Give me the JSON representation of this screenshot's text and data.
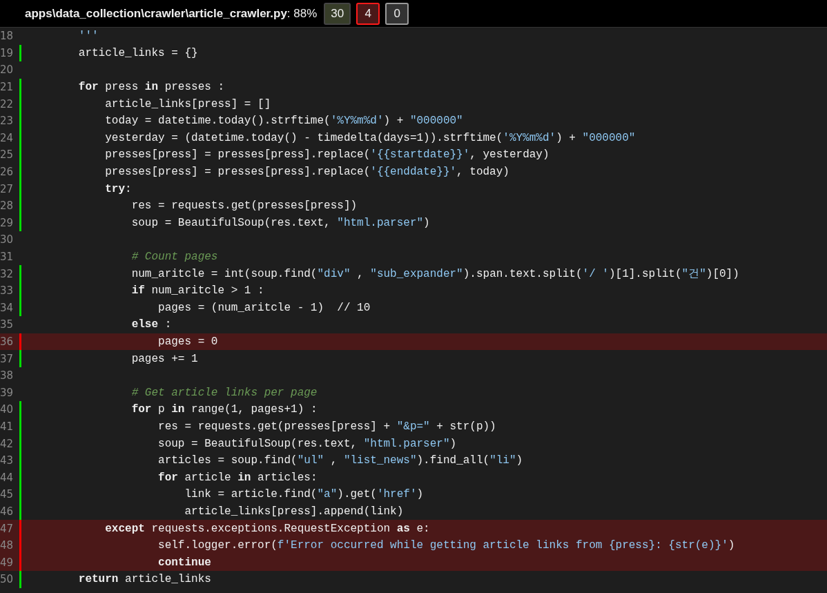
{
  "header": {
    "file": "apps\\data_collection\\crawler\\article_crawler.py",
    "coverage": ": 88%",
    "buttons": [
      {
        "kind": "run",
        "label": "30",
        "selected": false
      },
      {
        "kind": "mis",
        "label": "4",
        "selected": true
      },
      {
        "kind": "exc",
        "label": "0",
        "selected": true
      }
    ]
  },
  "lines": [
    {
      "n": "18",
      "kind": "none",
      "tokens": [
        {
          "kind": "str",
          "text": "        '''"
        }
      ]
    },
    {
      "n": "19",
      "kind": "run",
      "tokens": [
        {
          "kind": "txt",
          "text": "        article_links = {}"
        }
      ]
    },
    {
      "n": "20",
      "kind": "none"
    },
    {
      "n": "21",
      "kind": "run",
      "tokens": [
        {
          "kind": "kw",
          "text": "        for"
        },
        {
          "kind": "txt",
          "text": " press "
        },
        {
          "kind": "kw",
          "text": "in"
        },
        {
          "kind": "txt",
          "text": " presses :"
        }
      ]
    },
    {
      "n": "22",
      "kind": "run",
      "tokens": [
        {
          "kind": "txt",
          "text": "            article_links[press] = []"
        }
      ]
    },
    {
      "n": "23",
      "kind": "run",
      "tokens": [
        {
          "kind": "txt",
          "text": "            today = datetime.today().strftime("
        },
        {
          "kind": "str",
          "text": "'%Y%m%d'"
        },
        {
          "kind": "txt",
          "text": ") + "
        },
        {
          "kind": "str",
          "text": "\"000000\""
        }
      ]
    },
    {
      "n": "24",
      "kind": "run",
      "tokens": [
        {
          "kind": "txt",
          "text": "            yesterday = (datetime.today() - timedelta(days=1)).strftime("
        },
        {
          "kind": "str",
          "text": "'%Y%m%d'"
        },
        {
          "kind": "txt",
          "text": ") + "
        },
        {
          "kind": "str",
          "text": "\"000000\""
        }
      ]
    },
    {
      "n": "25",
      "kind": "run",
      "tokens": [
        {
          "kind": "txt",
          "text": "            presses[press] = presses[press].replace("
        },
        {
          "kind": "str",
          "text": "'{{startdate}}'"
        },
        {
          "kind": "txt",
          "text": ", yesterday)"
        }
      ]
    },
    {
      "n": "26",
      "kind": "run",
      "tokens": [
        {
          "kind": "txt",
          "text": "            presses[press] = presses[press].replace("
        },
        {
          "kind": "str",
          "text": "'{{enddate}}'"
        },
        {
          "kind": "txt",
          "text": ", today)"
        }
      ]
    },
    {
      "n": "27",
      "kind": "run",
      "tokens": [
        {
          "kind": "kw",
          "text": "            try"
        },
        {
          "kind": "txt",
          "text": ":"
        }
      ]
    },
    {
      "n": "28",
      "kind": "run",
      "tokens": [
        {
          "kind": "txt",
          "text": "                res = requests.get(presses[press])"
        }
      ]
    },
    {
      "n": "29",
      "kind": "run",
      "tokens": [
        {
          "kind": "txt",
          "text": "                soup = BeautifulSoup(res.text, "
        },
        {
          "kind": "str",
          "text": "\"html.parser\""
        },
        {
          "kind": "txt",
          "text": ")"
        }
      ]
    },
    {
      "n": "30",
      "kind": "none"
    },
    {
      "n": "31",
      "kind": "none",
      "tokens": [
        {
          "kind": "com",
          "text": "                # Count pages"
        }
      ]
    },
    {
      "n": "32",
      "kind": "run",
      "tokens": [
        {
          "kind": "txt",
          "text": "                num_aritcle = int(soup.find("
        },
        {
          "kind": "str",
          "text": "\"div\""
        },
        {
          "kind": "txt",
          "text": " , "
        },
        {
          "kind": "str",
          "text": "\"sub_expander\""
        },
        {
          "kind": "txt",
          "text": ").span.text.split("
        },
        {
          "kind": "str",
          "text": "'/ '"
        },
        {
          "kind": "txt",
          "text": ")[1].split("
        },
        {
          "kind": "str",
          "text": "\"건\""
        },
        {
          "kind": "txt",
          "text": ")[0])"
        }
      ]
    },
    {
      "n": "33",
      "kind": "run",
      "tokens": [
        {
          "kind": "kw",
          "text": "                if"
        },
        {
          "kind": "txt",
          "text": " num_aritcle > 1 :"
        }
      ]
    },
    {
      "n": "34",
      "kind": "run",
      "tokens": [
        {
          "kind": "txt",
          "text": "                    pages = (num_aritcle - 1)  // 10"
        }
      ]
    },
    {
      "n": "35",
      "kind": "none",
      "tokens": [
        {
          "kind": "kw",
          "text": "                else"
        },
        {
          "kind": "txt",
          "text": " :"
        }
      ]
    },
    {
      "n": "36",
      "kind": "mis",
      "tokens": [
        {
          "kind": "txt",
          "text": "                    pages = 0"
        }
      ]
    },
    {
      "n": "37",
      "kind": "run",
      "tokens": [
        {
          "kind": "txt",
          "text": "                pages += 1"
        }
      ]
    },
    {
      "n": "38",
      "kind": "none"
    },
    {
      "n": "39",
      "kind": "none",
      "tokens": [
        {
          "kind": "com",
          "text": "                # Get article links per page"
        }
      ]
    },
    {
      "n": "40",
      "kind": "run",
      "tokens": [
        {
          "kind": "kw",
          "text": "                for"
        },
        {
          "kind": "txt",
          "text": " p "
        },
        {
          "kind": "kw",
          "text": "in"
        },
        {
          "kind": "txt",
          "text": " range(1, pages+1) :"
        }
      ]
    },
    {
      "n": "41",
      "kind": "run",
      "tokens": [
        {
          "kind": "txt",
          "text": "                    res = requests.get(presses[press] + "
        },
        {
          "kind": "str",
          "text": "\"&p=\""
        },
        {
          "kind": "txt",
          "text": " + str(p))"
        }
      ]
    },
    {
      "n": "42",
      "kind": "run",
      "tokens": [
        {
          "kind": "txt",
          "text": "                    soup = BeautifulSoup(res.text, "
        },
        {
          "kind": "str",
          "text": "\"html.parser\""
        },
        {
          "kind": "txt",
          "text": ")"
        }
      ]
    },
    {
      "n": "43",
      "kind": "run",
      "tokens": [
        {
          "kind": "txt",
          "text": "                    articles = soup.find("
        },
        {
          "kind": "str",
          "text": "\"ul\""
        },
        {
          "kind": "txt",
          "text": " , "
        },
        {
          "kind": "str",
          "text": "\"list_news\""
        },
        {
          "kind": "txt",
          "text": ").find_all("
        },
        {
          "kind": "str",
          "text": "\"li\""
        },
        {
          "kind": "txt",
          "text": ")"
        }
      ]
    },
    {
      "n": "44",
      "kind": "run",
      "tokens": [
        {
          "kind": "kw",
          "text": "                    for"
        },
        {
          "kind": "txt",
          "text": " article "
        },
        {
          "kind": "kw",
          "text": "in"
        },
        {
          "kind": "txt",
          "text": " articles:"
        }
      ]
    },
    {
      "n": "45",
      "kind": "run",
      "tokens": [
        {
          "kind": "txt",
          "text": "                        link = article.find("
        },
        {
          "kind": "str",
          "text": "\"a\""
        },
        {
          "kind": "txt",
          "text": ").get("
        },
        {
          "kind": "str",
          "text": "'href'"
        },
        {
          "kind": "txt",
          "text": ")"
        }
      ]
    },
    {
      "n": "46",
      "kind": "run",
      "tokens": [
        {
          "kind": "txt",
          "text": "                        article_links[press].append(link)"
        }
      ]
    },
    {
      "n": "47",
      "kind": "mis",
      "tokens": [
        {
          "kind": "kw",
          "text": "            except"
        },
        {
          "kind": "txt",
          "text": " requests.exceptions.RequestException "
        },
        {
          "kind": "kw",
          "text": "as"
        },
        {
          "kind": "txt",
          "text": " e:"
        }
      ]
    },
    {
      "n": "48",
      "kind": "mis",
      "tokens": [
        {
          "kind": "txt",
          "text": "                    self.logger.error("
        },
        {
          "kind": "str",
          "text": "f'Error occurred while getting article links from {press}: {str(e)}'"
        },
        {
          "kind": "txt",
          "text": ")"
        }
      ]
    },
    {
      "n": "49",
      "kind": "mis",
      "tokens": [
        {
          "kind": "kw",
          "text": "                    continue"
        }
      ]
    },
    {
      "n": "50",
      "kind": "run",
      "tokens": [
        {
          "kind": "kw",
          "text": "        return"
        },
        {
          "kind": "txt",
          "text": " article_links"
        }
      ]
    }
  ]
}
